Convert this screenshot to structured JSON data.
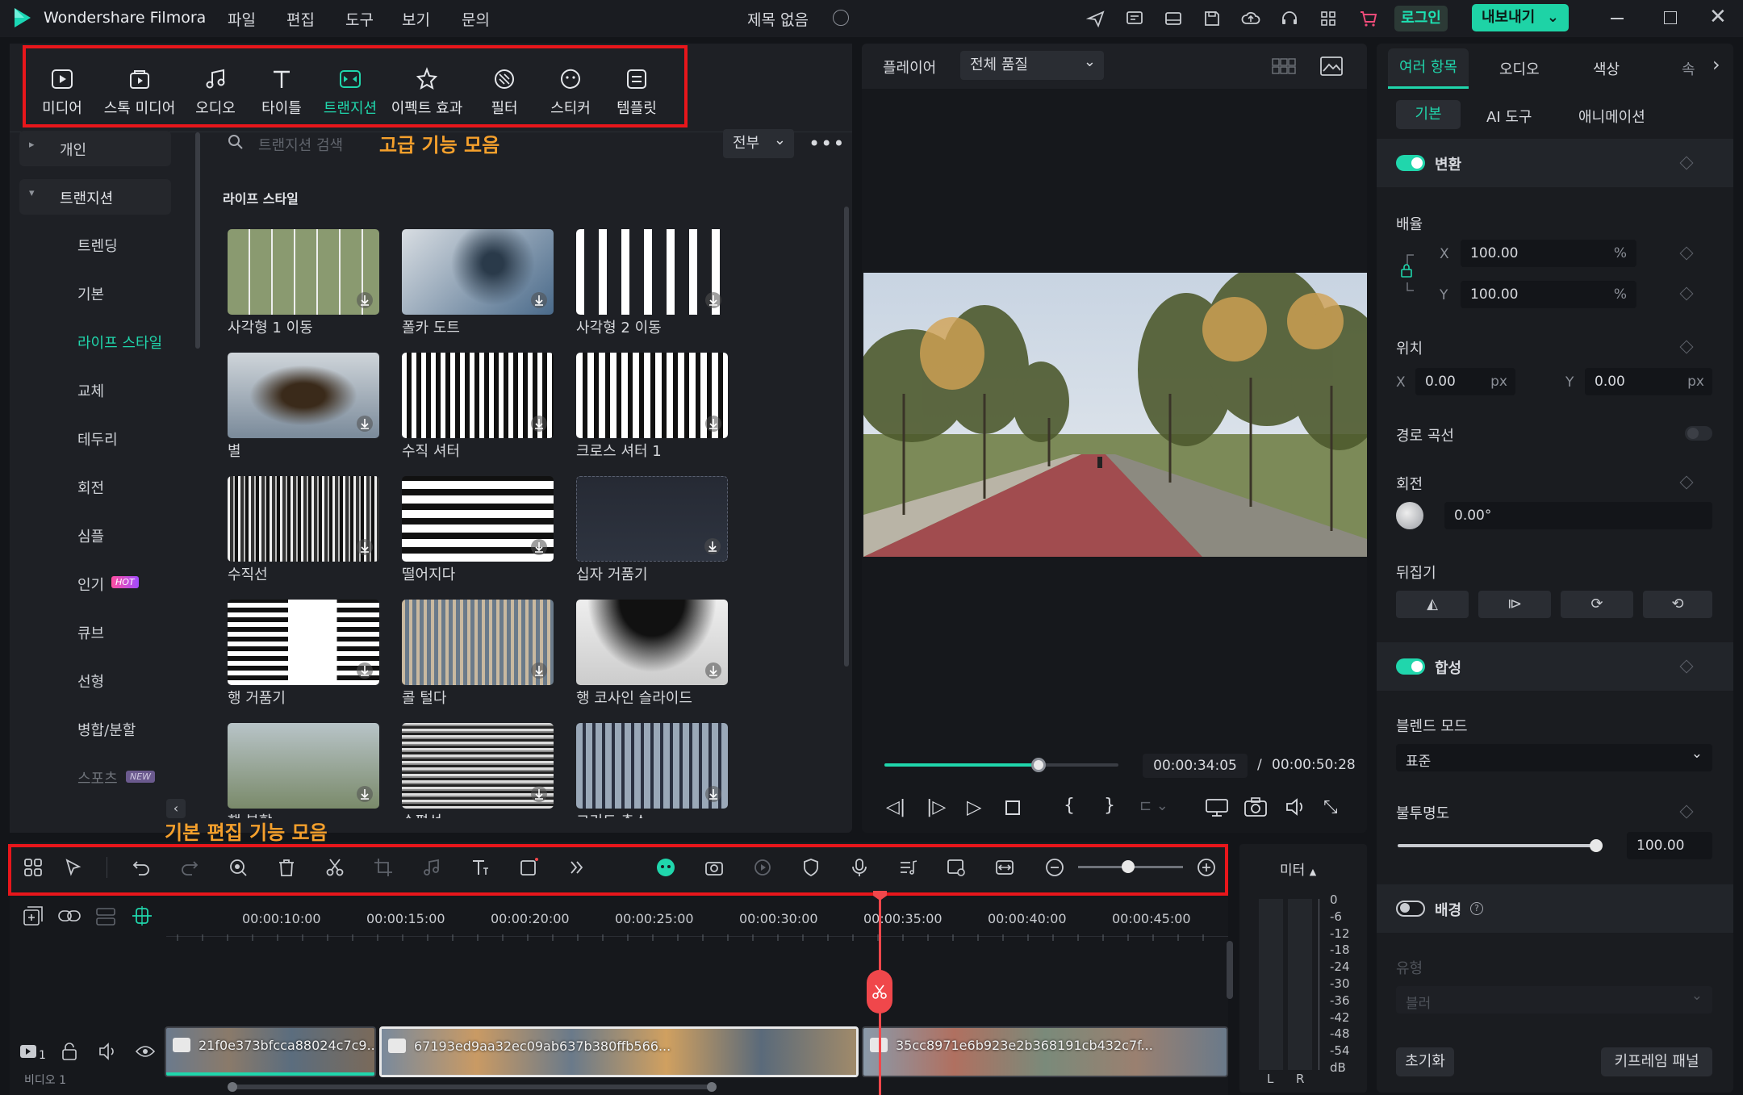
{
  "app": {
    "name": "Wondershare Filmora",
    "menu": [
      "파일",
      "편집",
      "도구",
      "보기",
      "문의"
    ],
    "project_title": "제목 없음",
    "login_label": "로그인",
    "export_label": "내보내기"
  },
  "toolbar": {
    "items": [
      "미디어",
      "스톡 미디어",
      "오디오",
      "타이틀",
      "트랜지션",
      "이펙트 효과",
      "필터",
      "스티커",
      "템플릿"
    ],
    "active_index": 4
  },
  "sidebar": {
    "personal": "개인",
    "section": "트랜지션",
    "items": [
      "트렌딩",
      "기본",
      "라이프 스타일",
      "교체",
      "테두리",
      "회전",
      "심플",
      "인기",
      "큐브",
      "선형",
      "병합/분할",
      "스포츠"
    ],
    "active_index": 2,
    "hot_badge": "HOT",
    "new_badge": "NEW"
  },
  "search": {
    "placeholder": "트랜지션 검색",
    "annotation": "고급 기능 모음",
    "filter": "전부"
  },
  "gallery": {
    "category": "라이프 스타일",
    "items": [
      "사각형 1 이동",
      "폴카 도트",
      "사각형 2 이동",
      "별",
      "수직 셔터",
      "크로스 셔터 1",
      "수직선",
      "떨어지다",
      "십자 거품기",
      "행 거품기",
      "콜 털다",
      "행 코사인 슬라이드",
      "행 분할",
      "수평선",
      "그리드 축소"
    ]
  },
  "player": {
    "label": "플레이어",
    "quality": "전체 품질",
    "current_time": "00:00:34:05",
    "separator": "/",
    "total_time": "00:00:50:28",
    "progress_fraction": 0.66
  },
  "props": {
    "tabs": [
      "여러 항목",
      "오디오",
      "색상",
      "속도"
    ],
    "subtabs": [
      "기본",
      "AI 도구",
      "애니메이션"
    ],
    "transform": "변환",
    "scale": "배율",
    "scale_x": "100.00",
    "scale_y": "100.00",
    "percent": "%",
    "x_label": "X",
    "y_label": "Y",
    "position": "위치",
    "pos_x": "0.00",
    "pos_y": "0.00",
    "px": "px",
    "path_curve": "경로 곡선",
    "rotation": "회전",
    "rotation_value": "0.00°",
    "flip": "뒤집기",
    "composite": "합성",
    "blend_mode": "블렌드 모드",
    "blend_value": "표준",
    "opacity": "불투명도",
    "opacity_value": "100.00",
    "background": "배경",
    "type_label": "유형",
    "type_value": "블러",
    "reset": "초기화",
    "keyframe_panel": "키프레임 패널"
  },
  "timeline": {
    "annotation": "기본 편집 기능 모음",
    "meter_label": "미터",
    "ruler": [
      "00:00:10:00",
      "00:00:15:00",
      "00:00:20:00",
      "00:00:25:00",
      "00:00:30:00",
      "00:00:35:00",
      "00:00:40:00",
      "00:00:45:00"
    ],
    "clips": [
      "21f0e373bfcca88024c7c9...",
      "67193ed9aa32ec09ab637b380ffb566...",
      "35cc8971e6b923e2b368191cb432c7f..."
    ],
    "track_label": "비디오 1",
    "track_number": "1",
    "db_scale": [
      "0",
      "-6",
      "-12",
      "-18",
      "-24",
      "-30",
      "-36",
      "-42",
      "-48",
      "-54",
      "dB"
    ],
    "lr": [
      "L",
      "R"
    ]
  },
  "colors": {
    "accent": "#20d6ac",
    "annotation": "#f5a02c",
    "highlight_box": "#e8161b",
    "playhead": "#f0474b",
    "login_text": "#1de2b3"
  }
}
